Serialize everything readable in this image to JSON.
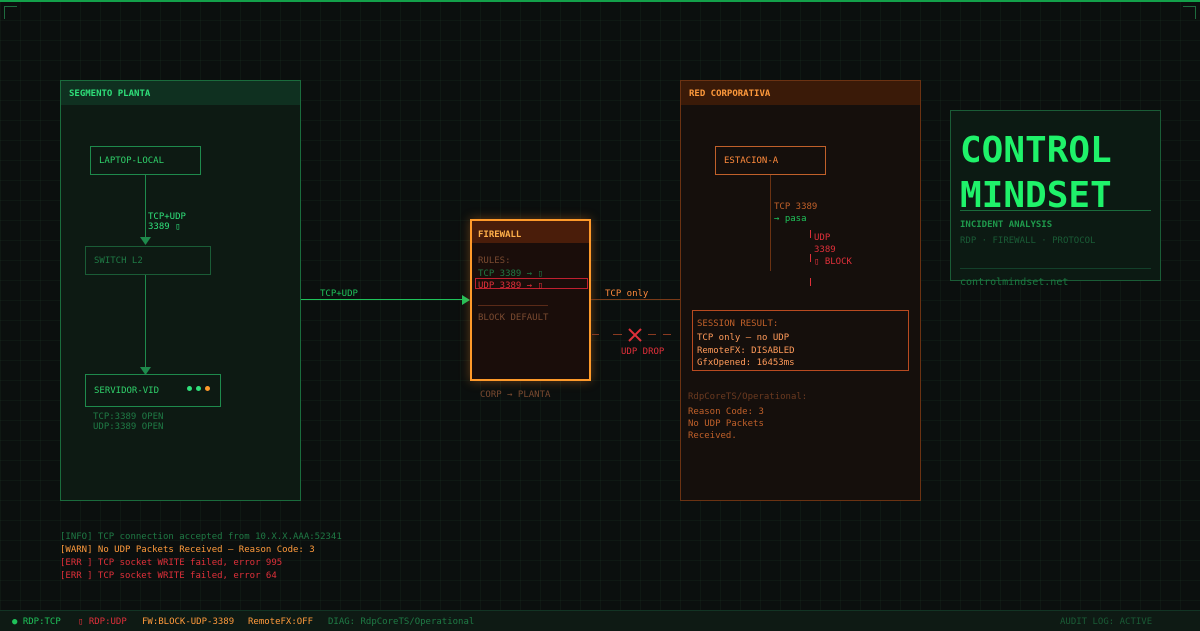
{
  "colors": {
    "green": "#1fc25a",
    "orange": "#ff9a3c",
    "red": "#e0303a",
    "dim_green": "#1f7a45"
  },
  "planta": {
    "title": "SEGMENTO PLANTA",
    "laptop": "LAPTOP-LOCAL",
    "link_label": "TCP+UDP\n3389 ▯",
    "switch": "SWITCH L2",
    "servidor": "SERVIDOR-VID",
    "servidor_ports": "TCP:3389 OPEN\nUDP:3389 OPEN"
  },
  "firewall": {
    "title": "FIREWALL",
    "rules_label": "RULES:",
    "rule_tcp": "TCP 3389 → ▯",
    "rule_udp": "UDP 3389 → ▯",
    "block_default": "BLOCK DEFAULT",
    "caption": "CORP → PLANTA",
    "in_label": "TCP+UDP",
    "out_label": "TCP only",
    "drop_label": "UDP DROP"
  },
  "corp": {
    "title": "RED CORPORATIVA",
    "estacion": "ESTACION-A",
    "tcp_label": "TCP 3389",
    "tcp_pass": "→ pasa",
    "udp_label": "UDP\n3389\n▯ BLOCK",
    "session_title": "SESSION RESULT:",
    "session_lines": "TCP only — no UDP\nRemoteFX: DISABLED\nGfxOpened: 16453ms",
    "diag_title": "RdpCoreTS/Operational:",
    "diag_lines": "Reason Code: 3\nNo UDP Packets\nReceived."
  },
  "brand": {
    "title": "CONTROL\nMINDSET",
    "subtitle": "INCIDENT ANALYSIS",
    "tags": "RDP · FIREWALL · PROTOCOL",
    "url": "controlmindset.net"
  },
  "logs": {
    "info": "[INFO] TCP connection accepted from 10.X.X.AAA:52341",
    "warn": "[WARN] No UDP Packets Received — Reason Code: 3",
    "err1": "[ERR ] TCP socket WRITE failed, error 995",
    "err2": "[ERR ] TCP socket WRITE failed, error 64"
  },
  "footer": {
    "rdp_tcp": "● RDP:TCP",
    "rdp_udp": "▯ RDP:UDP",
    "fw": "FW:BLOCK-UDP-3389",
    "remotefx": "RemoteFX:OFF",
    "diag": "DIAG: RdpCoreTS/Operational",
    "audit": "AUDIT LOG: ACTIVE"
  }
}
